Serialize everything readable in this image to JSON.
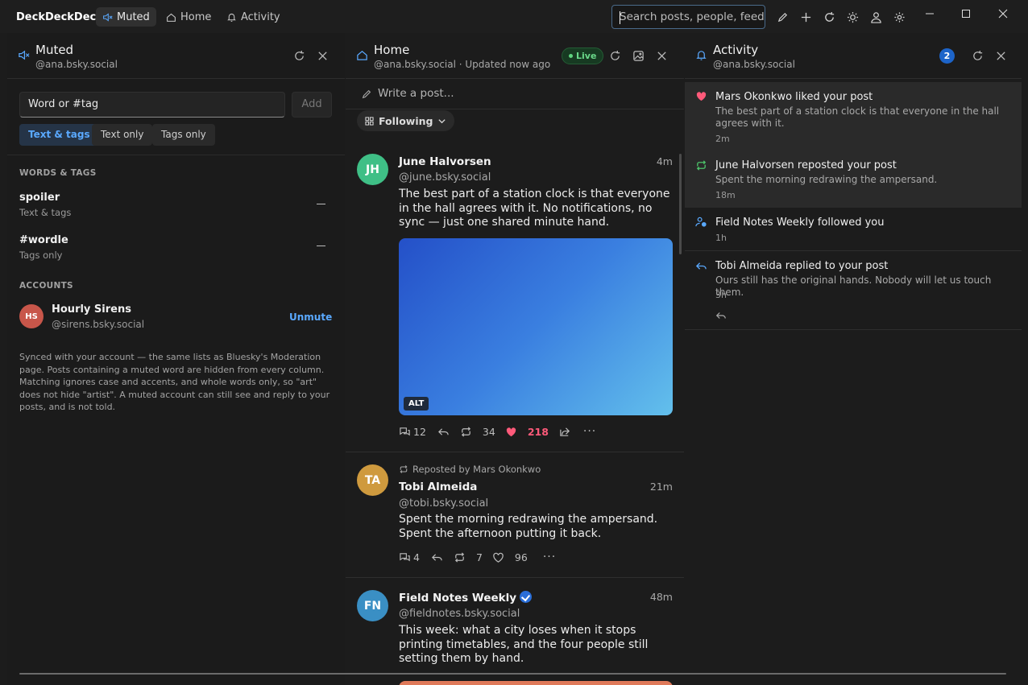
{
  "app": {
    "title": "DeckDeckDeck"
  },
  "tabs": [
    {
      "label": "Muted"
    },
    {
      "label": "Home"
    },
    {
      "label": "Activity"
    }
  ],
  "search": {
    "placeholder": "Search posts, people, feeds"
  },
  "muted": {
    "title": "Muted",
    "account": "@ana.bsky.social",
    "input_placeholder": "Word or #tag",
    "add_label": "Add",
    "modes": [
      "Text & tags",
      "Text only",
      "Tags only"
    ],
    "words_heading": "WORDS & TAGS",
    "words": [
      {
        "word": "spoiler",
        "scope": "Text & tags"
      },
      {
        "word": "#wordle",
        "scope": "Tags only"
      }
    ],
    "accounts_heading": "ACCOUNTS",
    "accounts": [
      {
        "initials": "HS",
        "name": "Hourly Sirens",
        "handle": "@sirens.bsky.social",
        "action": "Unmute"
      }
    ],
    "note": "Synced with your account — the same lists as Bluesky's Moderation page. Posts containing a muted word are hidden from every column. Matching ignores case and accents, and whole words only, so \"art\" does not hide \"artist\". A muted account can still see and reply to your posts, and is not told."
  },
  "home": {
    "title": "Home",
    "subtitle": "@ana.bsky.social · Updated now ago",
    "live": "Live",
    "compose_placeholder": "Write a post...",
    "feed_selector": "Following",
    "posts": [
      {
        "initials": "JH",
        "name": "June Halvorsen",
        "handle": "@june.bsky.social",
        "time": "4m",
        "text": "The best part of a station clock is that everyone in the hall agrees with it. No notifications, no sync — just one shared minute hand.",
        "alt": "ALT",
        "replies": "12",
        "reposts": "34",
        "likes": "218"
      },
      {
        "reposted_by": "Reposted by Mars Okonkwo",
        "initials": "TA",
        "name": "Tobi Almeida",
        "handle": "@tobi.bsky.social",
        "time": "21m",
        "text": "Spent the morning redrawing the ampersand. Spent the afternoon putting it back.",
        "replies": "4",
        "reposts": "7",
        "likes": "96"
      },
      {
        "initials": "FN",
        "name": "Field Notes Weekly",
        "handle": "@fieldnotes.bsky.social",
        "time": "48m",
        "text": "This week: what a city loses when it stops printing timetables, and the four people still setting them by hand."
      }
    ]
  },
  "activity": {
    "title": "Activity",
    "account": "@ana.bsky.social",
    "badge": "2",
    "items": [
      {
        "title": "Mars Okonkwo liked your post",
        "text": "The best part of a station clock is that everyone in the hall agrees with it.",
        "time": "2m"
      },
      {
        "title": "June Halvorsen reposted your post",
        "text": "Spent the morning redrawing the ampersand.",
        "time": "18m"
      },
      {
        "title": "Field Notes Weekly followed you",
        "time": "1h"
      },
      {
        "title": "Tobi Almeida replied to your post",
        "text": "Ours still has the original hands. Nobody will let us touch them.",
        "time": "3h"
      }
    ]
  },
  "colors": {
    "accent": "#5aa9ff",
    "like": "#ff5a7a",
    "repost": "#4cc46a",
    "background": "#1c1c1c"
  }
}
